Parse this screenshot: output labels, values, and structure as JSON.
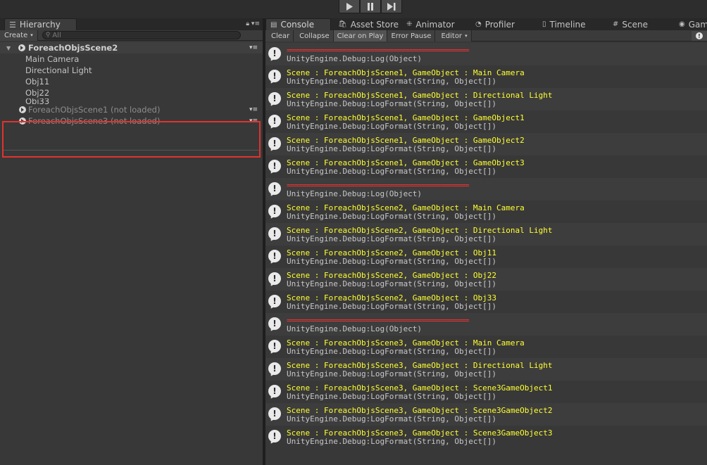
{
  "playbar": {
    "play_icon": "play-icon",
    "pause_icon": "pause-icon",
    "step_icon": "step-icon"
  },
  "hierarchy": {
    "tab_label": "Hierarchy",
    "create_label": "Create",
    "search_placeholder": "All",
    "scene": {
      "name": "ForeachObjsScene2",
      "children": [
        "Main Camera",
        "Directional Light",
        "Obj11",
        "Obj22",
        "Obj33"
      ]
    },
    "unloaded": [
      "ForeachObjsScene1 (not loaded)",
      "ForeachObjsScene3 (not loaded)"
    ]
  },
  "console": {
    "tabs": [
      "Console",
      "Asset Store",
      "Animator",
      "Profiler",
      "Timeline",
      "Scene",
      "Gam"
    ],
    "toolbar": [
      "Clear",
      "Collapse",
      "Clear on Play",
      "Error Pause",
      "Editor"
    ],
    "entries": [
      {
        "line1": "==============================================",
        "line2": "UnityEngine.Debug:Log(Object)",
        "kind": "sep"
      },
      {
        "line1": "Scene : ForeachObjsScene1, GameObject : Main Camera",
        "line2": "UnityEngine.Debug:LogFormat(String, Object[])",
        "kind": "msg"
      },
      {
        "line1": "Scene : ForeachObjsScene1, GameObject : Directional Light",
        "line2": "UnityEngine.Debug:LogFormat(String, Object[])",
        "kind": "msg"
      },
      {
        "line1": "Scene : ForeachObjsScene1, GameObject : GameObject1",
        "line2": "UnityEngine.Debug:LogFormat(String, Object[])",
        "kind": "msg"
      },
      {
        "line1": "Scene : ForeachObjsScene1, GameObject : GameObject2",
        "line2": "UnityEngine.Debug:LogFormat(String, Object[])",
        "kind": "msg"
      },
      {
        "line1": "Scene : ForeachObjsScene1, GameObject : GameObject3",
        "line2": "UnityEngine.Debug:LogFormat(String, Object[])",
        "kind": "msg"
      },
      {
        "line1": "==============================================",
        "line2": "UnityEngine.Debug:Log(Object)",
        "kind": "sep"
      },
      {
        "line1": "Scene : ForeachObjsScene2, GameObject : Main Camera",
        "line2": "UnityEngine.Debug:LogFormat(String, Object[])",
        "kind": "msg"
      },
      {
        "line1": "Scene : ForeachObjsScene2, GameObject : Directional Light",
        "line2": "UnityEngine.Debug:LogFormat(String, Object[])",
        "kind": "msg"
      },
      {
        "line1": "Scene : ForeachObjsScene2, GameObject : Obj11",
        "line2": "UnityEngine.Debug:LogFormat(String, Object[])",
        "kind": "msg"
      },
      {
        "line1": "Scene : ForeachObjsScene2, GameObject : Obj22",
        "line2": "UnityEngine.Debug:LogFormat(String, Object[])",
        "kind": "msg"
      },
      {
        "line1": "Scene : ForeachObjsScene2, GameObject : Obj33",
        "line2": "UnityEngine.Debug:LogFormat(String, Object[])",
        "kind": "msg"
      },
      {
        "line1": "==============================================",
        "line2": "UnityEngine.Debug:Log(Object)",
        "kind": "sep"
      },
      {
        "line1": "Scene : ForeachObjsScene3, GameObject : Main Camera",
        "line2": "UnityEngine.Debug:LogFormat(String, Object[])",
        "kind": "msg"
      },
      {
        "line1": "Scene : ForeachObjsScene3, GameObject : Directional Light",
        "line2": "UnityEngine.Debug:LogFormat(String, Object[])",
        "kind": "msg"
      },
      {
        "line1": "Scene : ForeachObjsScene3, GameObject : Scene3GameObject1",
        "line2": "UnityEngine.Debug:LogFormat(String, Object[])",
        "kind": "msg"
      },
      {
        "line1": "Scene : ForeachObjsScene3, GameObject : Scene3GameObject2",
        "line2": "UnityEngine.Debug:LogFormat(String, Object[])",
        "kind": "msg"
      },
      {
        "line1": "Scene : ForeachObjsScene3, GameObject : Scene3GameObject3",
        "line2": "UnityEngine.Debug:LogFormat(String, Object[])",
        "kind": "msg"
      }
    ]
  },
  "colors": {
    "log_yellow": "#ffff33",
    "separator_red": "#ff3030",
    "highlight_red": "#e0332e"
  }
}
